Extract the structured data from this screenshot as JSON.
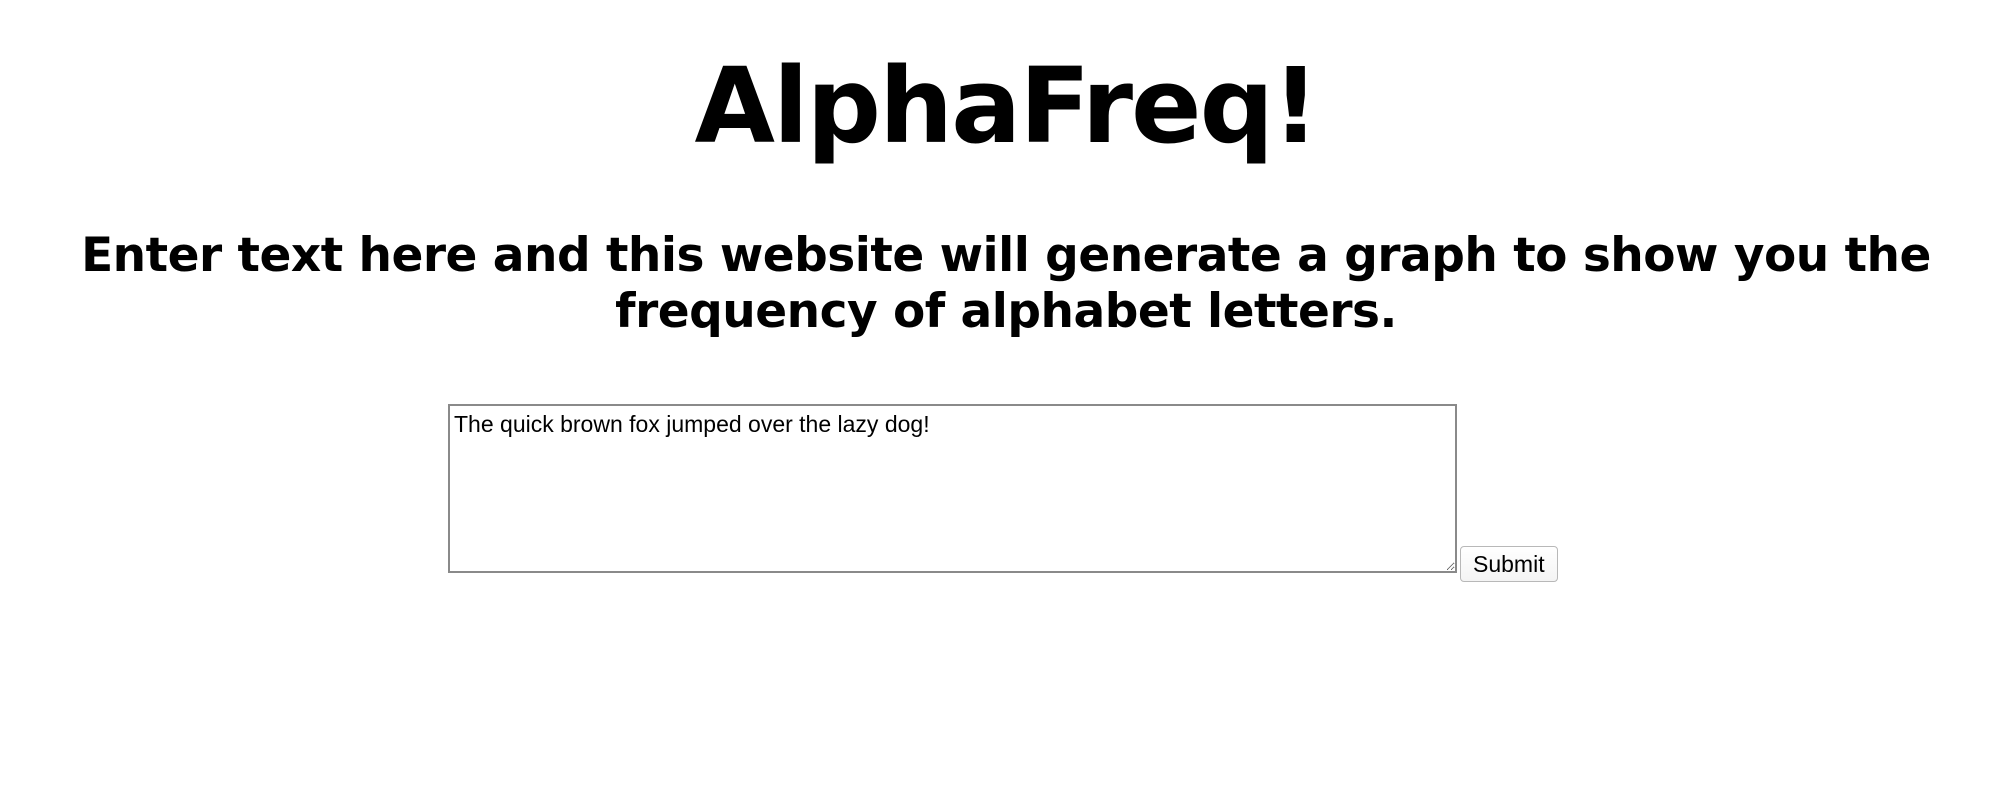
{
  "page": {
    "title": "AlphaFreq!",
    "subtitle": "Enter text here and this website will generate a graph to show you the frequency of alphabet letters."
  },
  "form": {
    "text_value": "The quick brown fox jumped over the lazy dog!",
    "submit_label": "Submit"
  }
}
